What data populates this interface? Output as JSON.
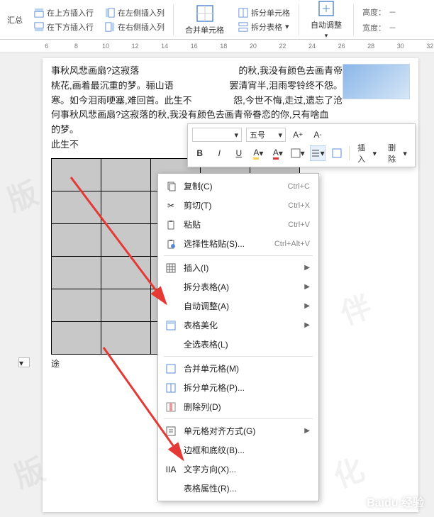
{
  "ribbon": {
    "summary": "汇总",
    "insert_row_above": "在上方插入行",
    "insert_row_below": "在下方插入行",
    "insert_col_left": "在左侧插入列",
    "insert_col_right": "在右侧插入列",
    "merge_cells": "合并单元格",
    "split_cells": "拆分单元格",
    "split_table": "拆分表格",
    "auto_fit": "自动调整",
    "height_label": "高度：",
    "width_label": "宽度：",
    "height_val": "－",
    "width_val": "－"
  },
  "ruler": {
    "marks": [
      "6",
      "8",
      "10",
      "12",
      "14",
      "16",
      "18",
      "20",
      "22",
      "24",
      "26",
      "28",
      "30",
      "32"
    ]
  },
  "document": {
    "line1": "事秋风悲画扇?这寂落",
    "line1b": "的秋,我没有颜色去画青帝",
    "line2": "桃花,画着最沉重的梦。骊山语",
    "line2b": "罢清宵半,泪雨零铃终不怨。",
    "line3": "寒。如今泪雨哽塞,难回首。此生不",
    "line3b": "怨,今世不悔,走过,遗忘了沧",
    "line4": "何事秋风悲画扇?这寂落的秋,我没有颜色去画青帝眷恋的你,只有啥血",
    "line5": "的梦。",
    "line6": "此生不",
    "caption": "途"
  },
  "mini_toolbar": {
    "font_size": "五号",
    "bold": "B",
    "italic": "I",
    "underline": "U",
    "insert": "插入",
    "delete": "删除"
  },
  "context_menu": {
    "copy": {
      "label": "复制(C)",
      "shortcut": "Ctrl+C"
    },
    "cut": {
      "label": "剪切(T)",
      "shortcut": "Ctrl+X"
    },
    "paste": {
      "label": "粘贴",
      "shortcut": "Ctrl+V"
    },
    "paste_special": {
      "label": "选择性粘贴(S)...",
      "shortcut": "Ctrl+Alt+V"
    },
    "insert": {
      "label": "插入(I)"
    },
    "split_table": {
      "label": "拆分表格(A)"
    },
    "auto_fit": {
      "label": "自动调整(A)"
    },
    "beautify": {
      "label": "表格美化"
    },
    "select_all": {
      "label": "全选表格(L)"
    },
    "merge": {
      "label": "合并单元格(M)"
    },
    "split_cell": {
      "label": "拆分单元格(P)..."
    },
    "delete_col": {
      "label": "删除列(D)"
    },
    "alignment": {
      "label": "单元格对齐方式(G)"
    },
    "borders": {
      "label": "边框和底纹(B)..."
    },
    "text_dir": {
      "label": "文字方向(X)..."
    },
    "properties": {
      "label": "表格属性(R)..."
    }
  },
  "footer": {
    "baidu": "Baidu 经验"
  }
}
